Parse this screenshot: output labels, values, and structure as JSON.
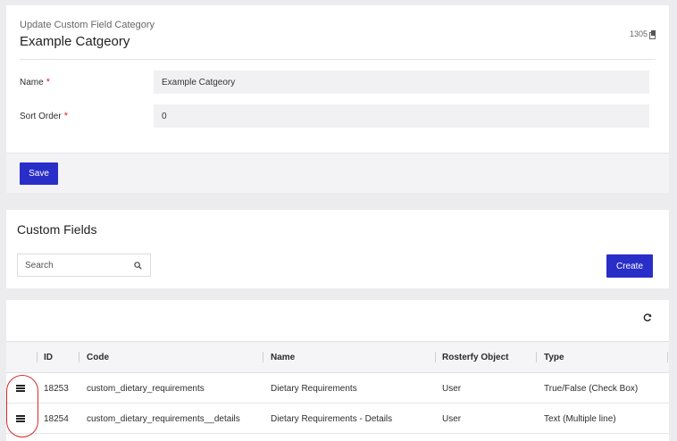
{
  "header": {
    "subtitle": "Update Custom Field Category",
    "title": "Example Catgeory",
    "record_id": "1305"
  },
  "form": {
    "name_label": "Name",
    "name_value": "Example Catgeory",
    "sort_label": "Sort Order",
    "sort_value": "0",
    "required_mark": "*",
    "save_label": "Save"
  },
  "fields_section": {
    "title": "Custom Fields",
    "search_placeholder": "Search",
    "create_label": "Create"
  },
  "table": {
    "columns": [
      "ID",
      "Code",
      "Name",
      "Rosterfy Object",
      "Type"
    ],
    "rows": [
      {
        "id": "18253",
        "code": "custom_dietary_requirements",
        "name": "Dietary Requirements",
        "object": "User",
        "type": "True/False (Check Box)"
      },
      {
        "id": "18254",
        "code": "custom_dietary_requirements__details",
        "name": "Dietary Requirements - Details",
        "object": "User",
        "type": "Text (Multiple line)"
      }
    ]
  },
  "colors": {
    "primary": "#2a2ec8",
    "required": "#d4262b",
    "highlight": "#d82a2a"
  },
  "icons": [
    "copy-icon",
    "search-icon",
    "refresh-icon",
    "drag-handle-icon"
  ]
}
